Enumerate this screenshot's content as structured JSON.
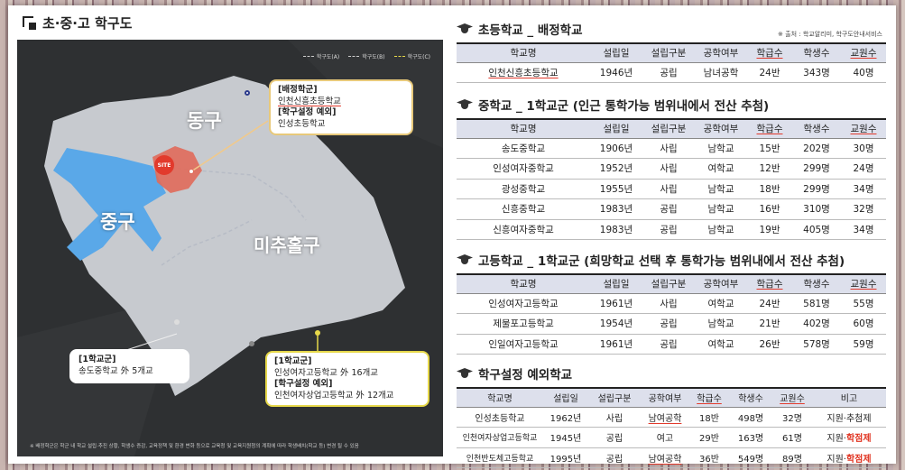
{
  "left": {
    "title": "초·중·고 학구도",
    "legend": [
      "학구도(A)",
      "학구도(B)",
      "학구도(C)"
    ],
    "districts": {
      "donggu": "동구",
      "junggu": "중구",
      "michuhol": "미추홀구"
    },
    "site_label": "SITE",
    "callout_elementary": {
      "line1": "[배정학군]",
      "line2": "인천신흥초등학교",
      "line3": "[학구설정 예외]",
      "line4": "인성초등학교"
    },
    "callout_middle": {
      "line1": "[1학교군]",
      "line2": "송도중학교 外 5개교"
    },
    "callout_high": {
      "line1": "[1학교군]",
      "line2": "인성여자고등학교 外 16개교",
      "line3": "[학구설정 예외]",
      "line4": "인천여자상업고등학교 外 12개교"
    },
    "note": "※ 배정학군은 학군 내 학교 설립·추진 상황, 학생수 증감, 교육정책 및 환경 변화 등으로 교육청 및 교육지원청의 계획에 따라 학생배치(학교 등) 변경 될 수 있음"
  },
  "colors": {
    "accent": "#e0321f",
    "header_bg": "#dde0ec",
    "callout_border": "#e8c97a",
    "district_fill": "#d3d6dc"
  },
  "sections": {
    "elementary": {
      "title": "초등학교 _ 배정학교",
      "source": "※ 출처 : 학교알리미, 학구도안내서비스",
      "headers": [
        "학교명",
        "설립일",
        "설립구분",
        "공학여부",
        "학급수",
        "학생수",
        "교원수"
      ],
      "rows": [
        [
          "인천신흥초등학교",
          "1946년",
          "공립",
          "남녀공학",
          "24반",
          "343명",
          "40명"
        ]
      ]
    },
    "middle": {
      "title": "중학교 _ 1학교군 (인근 통학가능 범위내에서 전산 추첨)",
      "headers": [
        "학교명",
        "설립일",
        "설립구분",
        "공학여부",
        "학급수",
        "학생수",
        "교원수"
      ],
      "rows": [
        [
          "송도중학교",
          "1906년",
          "사립",
          "남학교",
          "15반",
          "202명",
          "30명"
        ],
        [
          "인성여자중학교",
          "1952년",
          "사립",
          "여학교",
          "12반",
          "299명",
          "24명"
        ],
        [
          "광성중학교",
          "1955년",
          "사립",
          "남학교",
          "18반",
          "299명",
          "34명"
        ],
        [
          "신흥중학교",
          "1983년",
          "공립",
          "남학교",
          "16반",
          "310명",
          "32명"
        ],
        [
          "신흥여자중학교",
          "1983년",
          "공립",
          "남학교",
          "19반",
          "405명",
          "34명"
        ]
      ]
    },
    "high": {
      "title": "고등학교 _ 1학교군 (희망학교 선택 후 통학가능 범위내에서 전산 추첨)",
      "headers": [
        "학교명",
        "설립일",
        "설립구분",
        "공학여부",
        "학급수",
        "학생수",
        "교원수"
      ],
      "rows": [
        [
          "인성여자고등학교",
          "1961년",
          "사립",
          "여학교",
          "24반",
          "581명",
          "55명"
        ],
        [
          "제물포고등학교",
          "1954년",
          "공립",
          "남학교",
          "21반",
          "402명",
          "60명"
        ],
        [
          "인일여자고등학교",
          "1961년",
          "공립",
          "여학교",
          "26반",
          "578명",
          "59명"
        ]
      ]
    },
    "exception": {
      "title": "학구설정 예외학교",
      "headers": [
        "학교명",
        "설립일",
        "설립구분",
        "공학여부",
        "학급수",
        "학생수",
        "교원수",
        "비고"
      ],
      "rows": [
        [
          "인성초등학교",
          "1962년",
          "사립",
          "남여공학",
          "18반",
          "498명",
          "32명",
          "지원·추첨제",
          ""
        ],
        [
          "인천여자상업고등학교",
          "1945년",
          "공립",
          "여고",
          "29반",
          "163명",
          "61명",
          "지원·",
          "학점제"
        ],
        [
          "인천반도체고등학교",
          "1995년",
          "공립",
          "남여공학",
          "36반",
          "549명",
          "89명",
          "지원·",
          "학점제"
        ]
      ]
    }
  }
}
